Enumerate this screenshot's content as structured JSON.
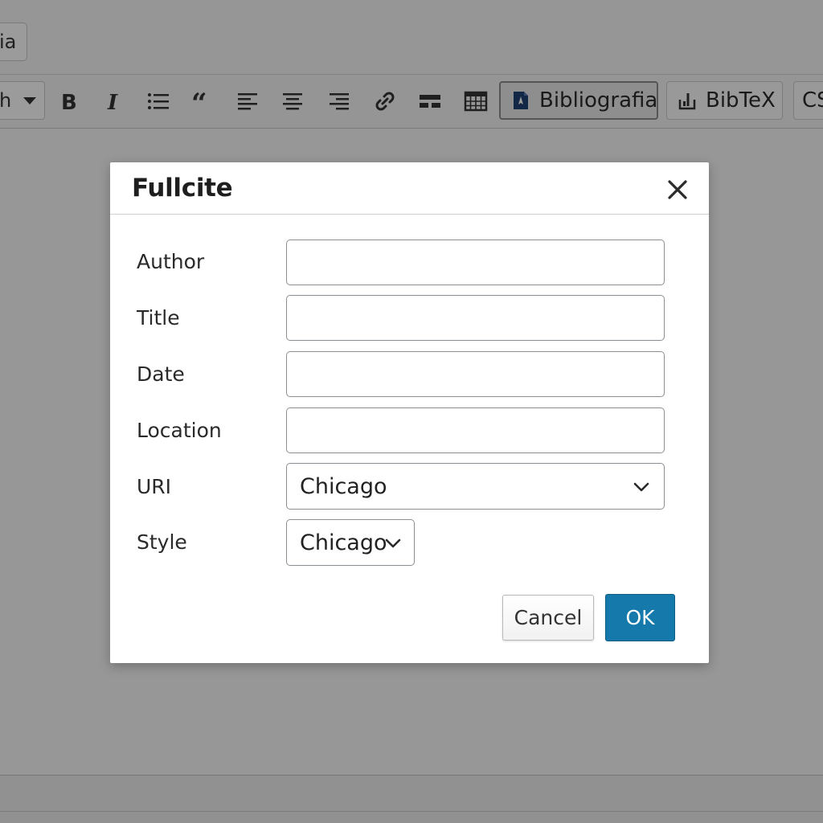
{
  "editor": {
    "top_tab_label": "ia",
    "format_label": "h",
    "toolbar": {
      "bibliografia_label": "Bibliografia",
      "bibtex_label": "BibTeX",
      "csl_label": "CS"
    }
  },
  "dialog": {
    "title": "Fullcite",
    "fields": {
      "author": {
        "label": "Author",
        "value": "",
        "placeholder": ""
      },
      "title": {
        "label": "Title",
        "value": "",
        "placeholder": ""
      },
      "date": {
        "label": "Date",
        "value": "",
        "placeholder": ""
      },
      "location": {
        "label": "Location",
        "value": "",
        "placeholder": ""
      },
      "uri": {
        "label": "URI",
        "selected": "Chicago"
      },
      "style": {
        "label": "Style",
        "selected": "Chicago"
      }
    },
    "buttons": {
      "cancel": "Cancel",
      "ok": "OK"
    }
  },
  "colors": {
    "primary_button": "#1679ab",
    "overlay": "rgba(0,0,0,0.38)"
  },
  "icons": [
    "bold-icon",
    "italic-icon",
    "bullet-list-icon",
    "blockquote-icon",
    "align-left-icon",
    "align-center-icon",
    "align-right-icon",
    "link-icon",
    "horizontal-rule-icon",
    "table-icon",
    "bibliography-icon",
    "bibtex-icon",
    "close-icon",
    "chevron-down-icon"
  ]
}
